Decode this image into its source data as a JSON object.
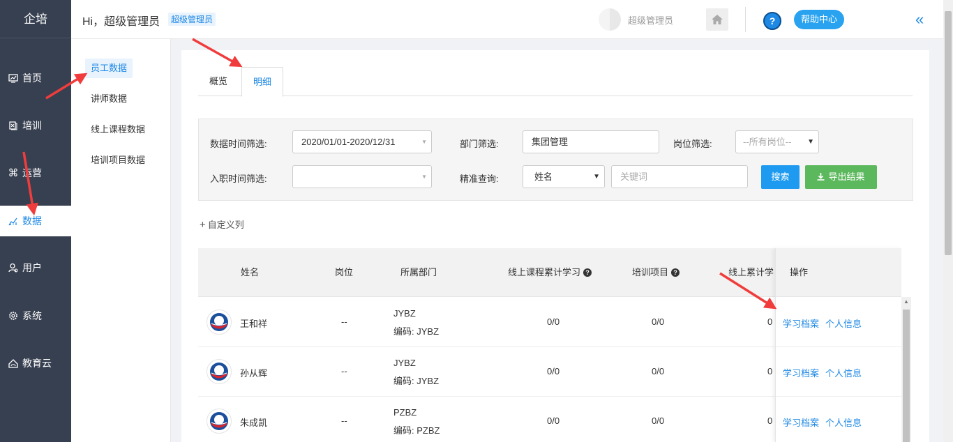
{
  "nav": {
    "brand": "企培",
    "items": [
      {
        "label": "首页",
        "icon": "dashboard-icon"
      },
      {
        "label": "培训",
        "icon": "book-icon"
      },
      {
        "label": "运营",
        "icon": "command-icon"
      },
      {
        "label": "数据",
        "icon": "chart-icon"
      },
      {
        "label": "用户",
        "icon": "user-icon"
      },
      {
        "label": "系统",
        "icon": "gear-icon"
      },
      {
        "label": "教育云",
        "icon": "cloud-home-icon"
      }
    ],
    "active": "数据"
  },
  "subnav": {
    "items": [
      "员工数据",
      "讲师数据",
      "线上课程数据",
      "培训项目数据"
    ],
    "active": "员工数据"
  },
  "header": {
    "greeting": "Hi，超级管理员",
    "role_badge": "超级管理员",
    "user_role": "超级管理员",
    "help_label": "帮助中心",
    "help_icon": "?",
    "collapse_icon": "«"
  },
  "tabs": [
    "概览",
    "明细"
  ],
  "active_tab": "明细",
  "filters": {
    "date_label": "数据时间筛选:",
    "date_value": "2020/01/01-2020/12/31",
    "dept_label": "部门筛选:",
    "dept_value": "集团管理",
    "post_label": "岗位筛选:",
    "post_value": "--所有岗位--",
    "join_label": "入职时间筛选:",
    "join_value": "",
    "query_label": "精准查询:",
    "query_type": "姓名",
    "keyword_placeholder": "关键词",
    "search_label": "搜索",
    "export_label": "导出结果"
  },
  "custom_columns": "自定义列",
  "table": {
    "headers": [
      "姓名",
      "岗位",
      "所属部门",
      "线上课程累计学习",
      "培训项目",
      "线上累计学",
      "操作"
    ],
    "rows": [
      {
        "name": "王和祥",
        "post": "--",
        "dept": "JYBZ",
        "code": "编码: JYBZ",
        "online": "0/0",
        "project": "0/0",
        "total": "0"
      },
      {
        "name": "孙从辉",
        "post": "--",
        "dept": "JYBZ",
        "code": "编码: JYBZ",
        "online": "0/0",
        "project": "0/0",
        "total": "0"
      },
      {
        "name": "朱成凯",
        "post": "--",
        "dept": "PZBZ",
        "code": "编码: PZBZ",
        "online": "0/0",
        "project": "0/0",
        "total": "0"
      }
    ],
    "action_archive": "学习档案",
    "action_info": "个人信息"
  },
  "colors": {
    "nav_bg": "#374050",
    "accent": "#1e88e5",
    "search_btn": "#1e9bf0",
    "export_btn": "#5cb85c",
    "annotation_arrow": "#f03c3c"
  }
}
